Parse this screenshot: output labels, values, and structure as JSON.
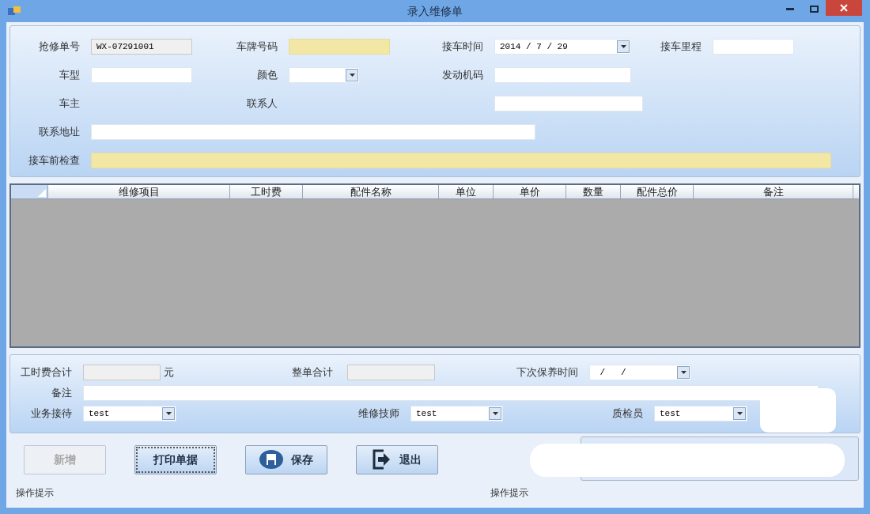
{
  "window": {
    "title": "录入维修单"
  },
  "top_form": {
    "rows": [
      [
        {
          "label": "抢修单号",
          "field": {
            "kind": "readonly",
            "value": "WX-07291001"
          }
        },
        {
          "label": "车牌号码",
          "field": {
            "kind": "required"
          }
        },
        {
          "label": "接车时间",
          "field": {
            "kind": "date",
            "value": "2014 / 7 / 29"
          }
        },
        {
          "label": "接车里程",
          "field": {
            "kind": "text"
          }
        }
      ],
      [
        {
          "label": "车型",
          "field": {
            "kind": "text"
          }
        },
        {
          "label": "颜色",
          "field": {
            "kind": "combo"
          }
        },
        {
          "label": "发动机码",
          "field": {
            "kind": "text"
          }
        }
      ],
      [
        {
          "label": "车主"
        },
        {
          "label": "联系人"
        },
        {
          "field": {
            "kind": "text"
          }
        }
      ]
    ],
    "address": {
      "label": "联系地址",
      "kind": "text"
    },
    "inspection": {
      "label": "接车前检查",
      "kind": "required"
    }
  },
  "table": {
    "columns": [
      "维修项目",
      "工时费",
      "配件名称",
      "单位",
      "单价",
      "数量",
      "配件总价",
      "备注"
    ]
  },
  "totals": {
    "labor_total": {
      "label": "工时费合计",
      "unit": "元"
    },
    "order_total": {
      "label": "整单合计"
    },
    "next_service": {
      "label": "下次保养时间",
      "value": " /   /"
    },
    "remark": {
      "label": "备注"
    },
    "staff": [
      {
        "label": "业务接待",
        "value": "test"
      },
      {
        "label": "维修技师",
        "value": "test"
      },
      {
        "label": "质检员",
        "value": "test"
      }
    ]
  },
  "buttons": [
    {
      "label": "新增",
      "kind": "plain",
      "disabled": true,
      "focused": false
    },
    {
      "label": "打印单据",
      "kind": "plain",
      "disabled": false,
      "focused": true
    },
    {
      "label": "保存",
      "kind": "save",
      "disabled": false,
      "focused": false
    },
    {
      "label": "退出",
      "kind": "exit",
      "disabled": false,
      "focused": false
    }
  ],
  "status_bar": [
    "操作提示",
    "操作提示"
  ]
}
